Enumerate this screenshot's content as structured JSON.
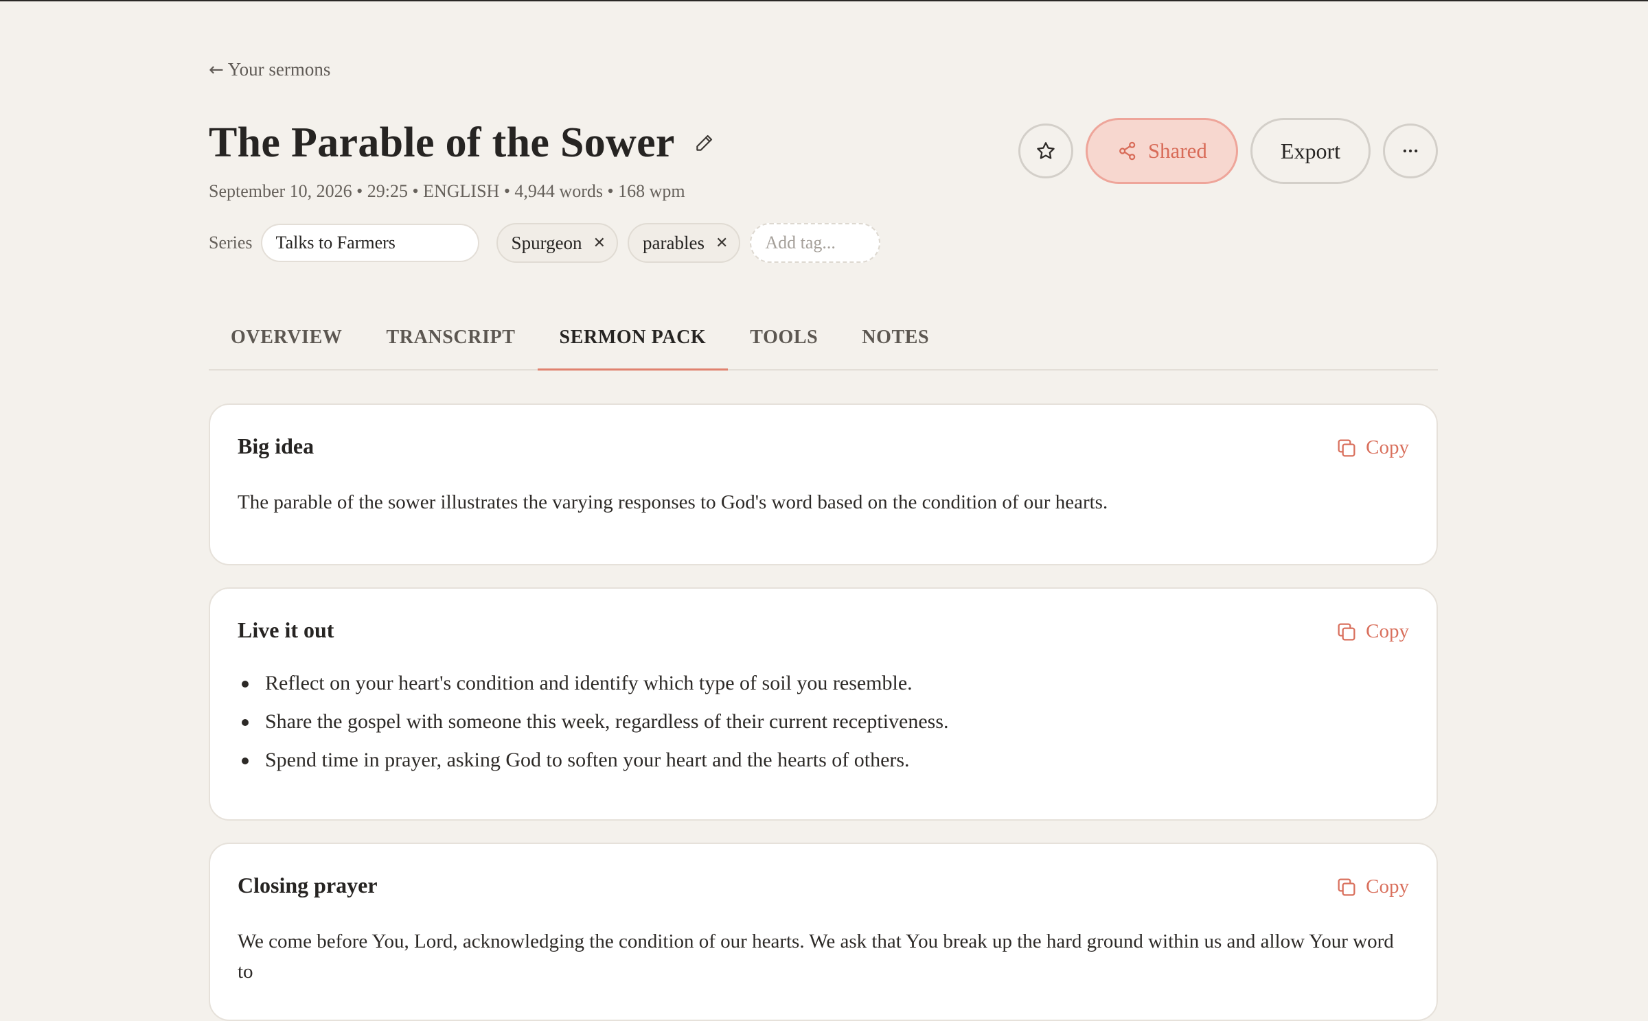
{
  "nav": {
    "back_label": "Your sermons"
  },
  "sermon": {
    "title": "The Parable of the Sower",
    "meta": "September 10, 2026 • 29:25 • ENGLISH • 4,944 words • 168 wpm",
    "series_label": "Series",
    "series_value": "Talks to Farmers",
    "tags": [
      "Spurgeon",
      "parables"
    ],
    "add_tag_placeholder": "Add tag..."
  },
  "actions": {
    "shared_label": "Shared",
    "export_label": "Export"
  },
  "tabs": [
    {
      "label": "OVERVIEW",
      "active": false
    },
    {
      "label": "TRANSCRIPT",
      "active": false
    },
    {
      "label": "SERMON PACK",
      "active": true
    },
    {
      "label": "TOOLS",
      "active": false
    },
    {
      "label": "NOTES",
      "active": false
    }
  ],
  "sections": {
    "copy_label": "Copy",
    "big_idea": {
      "title": "Big idea",
      "text": "The parable of the sower illustrates the varying responses to God's word based on the condition of our hearts."
    },
    "live_it_out": {
      "title": "Live it out",
      "items": [
        "Reflect on your heart's condition and identify which type of soil you resemble.",
        "Share the gospel with someone this week, regardless of their current receptiveness.",
        "Spend time in prayer, asking God to soften your heart and the hearts of others."
      ]
    },
    "closing_prayer": {
      "title": "Closing prayer",
      "text": "We come before You, Lord, acknowledging the condition of our hearts. We ask that You break up the hard ground within us and allow Your word to"
    }
  },
  "colors": {
    "accent": "#d9705d",
    "background": "#f4f1ec",
    "card": "#ffffff"
  },
  "icons": [
    "pencil-icon",
    "star-icon",
    "share-icon",
    "more-icon",
    "copy-icon",
    "close-icon"
  ]
}
